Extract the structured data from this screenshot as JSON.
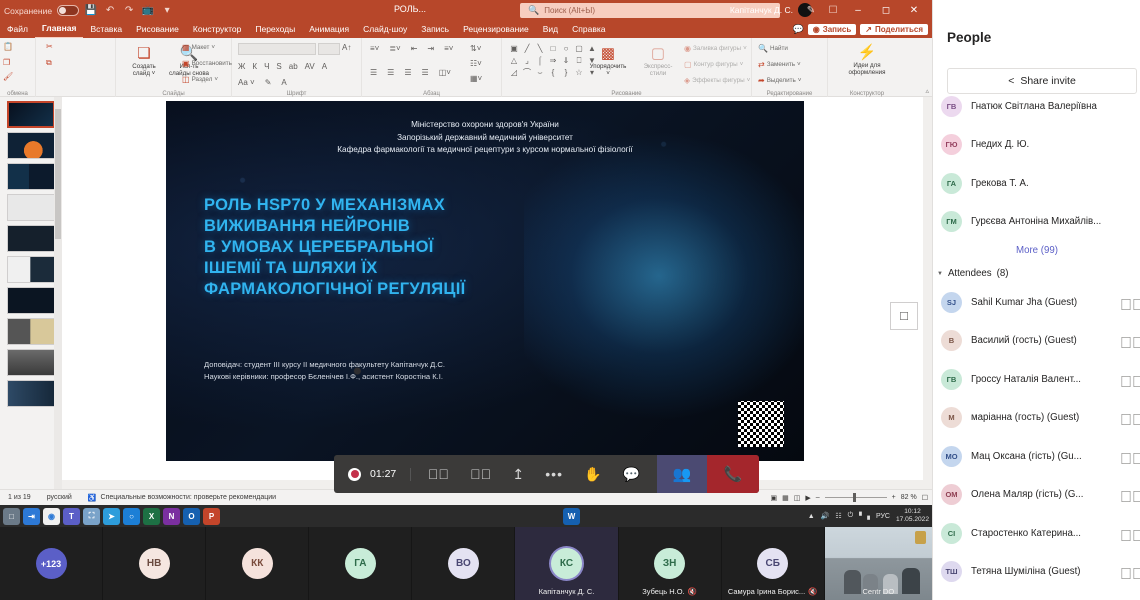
{
  "powerpoint": {
    "titlebar": {
      "autosave_label": "Сохранение",
      "doc_name": "РОЛЬ...",
      "search_placeholder": "Поиск (Alt+Ы)",
      "account_name": "Капітанчук Д. С.",
      "icons": [
        "save-icon",
        "undo-icon",
        "redo-icon",
        "present-icon",
        "customize-icon",
        "pen-icon",
        "restore-window-icon"
      ],
      "window_buttons": [
        "minimize",
        "maximize",
        "close"
      ]
    },
    "tabs": [
      {
        "label": "Файл",
        "active": false
      },
      {
        "label": "Главная",
        "active": true
      },
      {
        "label": "Вставка",
        "active": false
      },
      {
        "label": "Рисование",
        "active": false
      },
      {
        "label": "Конструктор",
        "active": false
      },
      {
        "label": "Переходы",
        "active": false
      },
      {
        "label": "Анимация",
        "active": false
      },
      {
        "label": "Слайд-шоу",
        "active": false
      },
      {
        "label": "Запись",
        "active": false
      },
      {
        "label": "Рецензирование",
        "active": false
      },
      {
        "label": "Вид",
        "active": false
      },
      {
        "label": "Справка",
        "active": false
      }
    ],
    "tabs_right": {
      "comments_icon": "comment-icon",
      "record_label": "Запись",
      "share_label": "Поделиться"
    },
    "ribbon": {
      "groups": [
        {
          "name": "Буфер обмена",
          "label": "обмена"
        },
        {
          "name": "Слайды",
          "label": "Слайды"
        },
        {
          "name": "Шрифт",
          "label": "Шрифт"
        },
        {
          "name": "Абзац",
          "label": "Абзац"
        },
        {
          "name": "Рисование",
          "label": "Рисование"
        },
        {
          "name": "Редактирование",
          "label": "Редактирование"
        },
        {
          "name": "Конструктор",
          "label": "Конструктор"
        }
      ],
      "buttons": {
        "new_slide": "Создать\nслайд",
        "new_slide_l1": "Создать",
        "new_slide_l2": "слайд ˅",
        "reuse_l1": "Исп-ть",
        "reuse_l2": "слайды снова",
        "layout": "Макет",
        "reset": "Восстановить",
        "section": "Раздел",
        "arrange": "Упорядочить",
        "quick_styles_l1": "Экспресс-",
        "quick_styles_l2": "стили",
        "shape_fill": "Заливка фигуры",
        "shape_outline": "Контур фигуры",
        "shape_effects": "Эффекты фигуры",
        "find": "Найти",
        "replace": "Заменить",
        "select": "Выделить",
        "design_ideas_l1": "Идеи для",
        "design_ideas_l2": "оформления"
      },
      "font_format": [
        "Ж",
        "К",
        "Ч",
        "S",
        "ab",
        "AV",
        "A"
      ]
    },
    "slide": {
      "header_lines": [
        "Міністерство охорони здоров'я України",
        "Запорізький державний медичний університет",
        "Кафедра фармакології та медичної рецептури з курсом нормальної фізіології"
      ],
      "title_lines": [
        "РОЛЬ HSP70 У МЕХАНІЗМАХ",
        "ВИЖИВАННЯ НЕЙРОНІВ",
        "В УМОВАХ ЦЕРЕБРАЛЬНОЇ",
        "ІШЕМІЇ ТА ШЛЯХИ ЇХ",
        "ФАРМАКОЛОГІЧНОЇ РЕГУЛЯЦІЇ"
      ],
      "footer_lines": [
        "Доповідач: студент III курсу II медичного факультету Капітанчук Д.С.",
        "Наукові керівники: професор Бєленічев І.Ф., асистент Коростіна К.І."
      ],
      "accent_color": "#31b4ef"
    },
    "statusbar": {
      "slide_counter": "1 из 19",
      "language": "русский",
      "accessibility": "Специальные возможности: проверьте рекомендации",
      "zoom": "82 %",
      "view_icons": [
        "normal-view-icon",
        "sorter-view-icon",
        "reading-view-icon",
        "slideshow-icon"
      ],
      "fit_icon": "fit-slide-icon"
    }
  },
  "taskbar": {
    "apps": [
      "start-icon",
      "search-icon",
      "chrome-icon",
      "teams-icon",
      "photos-icon",
      "telegram-icon",
      "edge-icon",
      "excel-icon",
      "onenote-icon",
      "outlook-icon",
      "powerpoint-icon",
      "word-icon"
    ],
    "tray": {
      "language": "РУС",
      "time": "10:12",
      "date": "17.05.2022",
      "icons": [
        "show-hidden-icon",
        "volume-icon",
        "network-icon",
        "battery-icon",
        "signal-icon"
      ]
    }
  },
  "meeting_controls": {
    "record_timer": "01:27",
    "buttons": [
      {
        "name": "recording-indicator",
        "icon": "record-dot"
      },
      {
        "name": "camera-toggle",
        "icon": "camera-off-icon"
      },
      {
        "name": "mic-toggle",
        "icon": "mic-off-icon"
      },
      {
        "name": "share-screen",
        "icon": "share-screen-icon"
      },
      {
        "name": "more-actions",
        "icon": "ellipsis-icon"
      },
      {
        "name": "raise-hand",
        "icon": "hand-icon"
      },
      {
        "name": "chat",
        "icon": "chat-icon"
      },
      {
        "name": "participants",
        "icon": "people-icon"
      },
      {
        "name": "leave-call",
        "icon": "hangup-icon"
      }
    ]
  },
  "video_strip": [
    {
      "initials": "+123",
      "name": "",
      "color": "#5b5fc7",
      "text_color": "#ffffff",
      "active": false,
      "muted": false,
      "overflow": true
    },
    {
      "initials": "НВ",
      "name": "",
      "color": "#f5e6e0",
      "text_color": "#6b4a3f",
      "active": false,
      "muted": false
    },
    {
      "initials": "КК",
      "name": "",
      "color": "#f5e2dc",
      "text_color": "#7a4b3c",
      "active": false,
      "muted": false
    },
    {
      "initials": "ГА",
      "name": "",
      "color": "#c8ecd8",
      "text_color": "#2e6b4a",
      "active": false,
      "muted": false
    },
    {
      "initials": "ВО",
      "name": "",
      "color": "#e4e2f2",
      "text_color": "#4a4773",
      "active": false,
      "muted": false
    },
    {
      "initials": "КС",
      "name": "Капітанчук Д. С.",
      "color": "#c8ecd8",
      "text_color": "#2e6b4a",
      "active": true,
      "muted": false
    },
    {
      "initials": "ЗН",
      "name": "Зубець Н.О.",
      "color": "#c8ecd8",
      "text_color": "#2e6b4a",
      "active": false,
      "muted": true
    },
    {
      "initials": "СБ",
      "name": "Самура Ірина Борис...",
      "color": "#e4e2f2",
      "text_color": "#4a4773",
      "active": false,
      "muted": true
    }
  ],
  "video_camera_tile": {
    "name": "Centr DO"
  },
  "people_panel": {
    "title": "People",
    "share_invite": "Share invite",
    "share_icon": "share-icon",
    "presenters": [
      {
        "initials": "ГВ",
        "name": "Гнатюк Світлана Валеріївна",
        "color": "#ecd9ef",
        "text_color": "#7a4e85"
      },
      {
        "initials": "ГЮ",
        "name": "Гнедих Д. Ю.",
        "color": "#f4cfdc",
        "text_color": "#94405f"
      },
      {
        "initials": "ГА",
        "name": "Грекова Т. А.",
        "color": "#c9e9d8",
        "text_color": "#2e6b4a"
      },
      {
        "initials": "ГМ",
        "name": "Гурєєва Антоніна Михайлів...",
        "color": "#c9e9d8",
        "text_color": "#2e6b4a"
      }
    ],
    "more_label": "More (99)",
    "attendees_section": "Attendees",
    "attendees_count": "(8)",
    "attendees": [
      {
        "initials": "SJ",
        "name": "Sahil Kumar Jha (Guest)",
        "color": "#c4d6ee",
        "text_color": "#33508a"
      },
      {
        "initials": "В",
        "name": "Василий (гость) (Guest)",
        "color": "#eddcd6",
        "text_color": "#7a5446"
      },
      {
        "initials": "ГВ",
        "name": "Гроссу Наталія Валент...",
        "color": "#c9e9d8",
        "text_color": "#2e6b4a"
      },
      {
        "initials": "М",
        "name": "маріанна (гость) (Guest)",
        "color": "#eddcd6",
        "text_color": "#7a5446"
      },
      {
        "initials": "МО",
        "name": "Мац Оксана (гість) (Gu...",
        "color": "#c4d6ee",
        "text_color": "#33508a"
      },
      {
        "initials": "ОМ",
        "name": "Олена Маляр (гість) (G...",
        "color": "#eecdd4",
        "text_color": "#8f3f52"
      },
      {
        "initials": "СІ",
        "name": "Старостенко Катерина...",
        "color": "#c9e9d8",
        "text_color": "#2e6b4a"
      },
      {
        "initials": "ТШ",
        "name": "Тетяна Шуміліна (Guest)",
        "color": "#ded9ef",
        "text_color": "#4a4773"
      }
    ],
    "row_icon": "camera-off-icon"
  }
}
